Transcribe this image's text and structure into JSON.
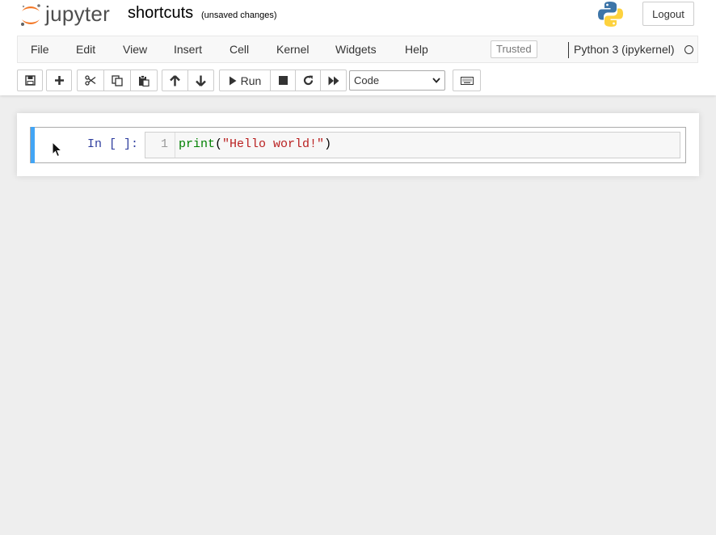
{
  "header": {
    "logo_text": "jupyter",
    "notebook_name": "shortcuts",
    "save_status": "(unsaved changes)",
    "logout_label": "Logout"
  },
  "menubar": {
    "items": [
      "File",
      "Edit",
      "View",
      "Insert",
      "Cell",
      "Kernel",
      "Widgets",
      "Help"
    ],
    "trusted_label": "Trusted",
    "kernel_name": "Python 3 (ipykernel)",
    "kernel_status": "idle"
  },
  "toolbar": {
    "run_label": "Run",
    "cell_type": "Code",
    "cell_type_options": [
      "Code"
    ]
  },
  "cell": {
    "prompt": "In [ ]:",
    "line_number": "1",
    "code_func": "print",
    "code_open": "(",
    "code_string": "\"Hello world!\"",
    "code_close": ")"
  },
  "colors": {
    "cell_selected_bar": "#42a5f5",
    "jupyter_orange": "#f37726",
    "prompt_blue": "#303f9f",
    "builtin_green": "#008000",
    "string_red": "#ba2121"
  }
}
